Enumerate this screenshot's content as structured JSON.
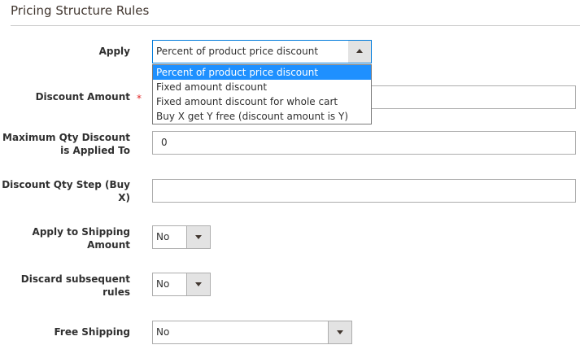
{
  "section": {
    "title": "Pricing Structure Rules"
  },
  "fields": {
    "apply": {
      "label": "Apply",
      "value": "Percent of product price discount",
      "options": [
        "Percent of product price discount",
        "Fixed amount discount",
        "Fixed amount discount for whole cart",
        "Buy X get Y free (discount amount is Y)"
      ]
    },
    "discount_amount": {
      "label": "Discount Amount",
      "required_mark": "*",
      "value": ""
    },
    "max_qty_discount": {
      "label_line1": "Maximum Qty Discount",
      "label_line2": "is Applied To",
      "value": "0"
    },
    "discount_qty_step": {
      "label_line1": "Discount Qty Step (Buy",
      "label_line2": "X)",
      "value": ""
    },
    "apply_to_shipping": {
      "label_line1": "Apply to Shipping",
      "label_line2": "Amount",
      "value": "No"
    },
    "discard_subsequent": {
      "label_line1": "Discard subsequent",
      "label_line2": "rules",
      "value": "No"
    },
    "free_shipping": {
      "label": "Free Shipping",
      "value": "No"
    }
  }
}
